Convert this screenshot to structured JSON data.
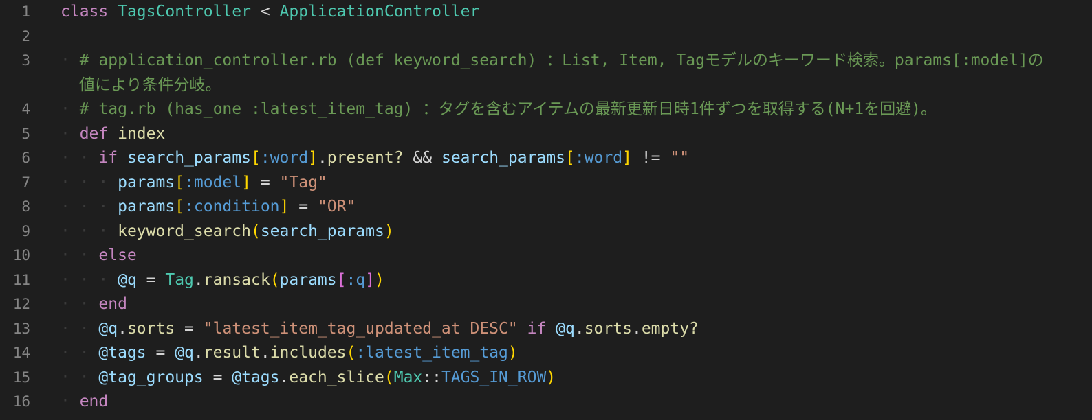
{
  "editor": {
    "colors": {
      "background": "#1e1e1e",
      "line_number": "#858585",
      "keyword": "#c586c0",
      "class_name": "#4ec9b0",
      "comment": "#6a9955",
      "function": "#dcdcaa",
      "variable": "#9cdcfe",
      "symbol": "#569cd6",
      "string": "#ce9178",
      "bracket_level1": "#ffd700",
      "bracket_level2": "#da70d6"
    },
    "lines": [
      {
        "number": "1",
        "tokens": [
          [
            "kw",
            "class"
          ],
          [
            "op",
            " "
          ],
          [
            "cls",
            "TagsController"
          ],
          [
            "op",
            " < "
          ],
          [
            "cls",
            "ApplicationController"
          ]
        ]
      },
      {
        "number": "2",
        "tokens": []
      },
      {
        "number": "3",
        "tokens": [
          [
            "ws",
            "· "
          ],
          [
            "cm",
            "# application_controller.rb (def keyword_search) ：List, Item, Tagモデルのキーワード検索。params[:model]の"
          ]
        ],
        "wrap": "値により条件分岐。"
      },
      {
        "number": "4",
        "tokens": [
          [
            "ws",
            "· "
          ],
          [
            "cm",
            "# tag.rb (has_one :latest_item_tag) ：タグを含むアイテムの最新更新日時1件ずつを取得する(N+1を回避)。"
          ]
        ]
      },
      {
        "number": "5",
        "tokens": [
          [
            "ws",
            "· "
          ],
          [
            "kw",
            "def"
          ],
          [
            "op",
            " "
          ],
          [
            "fn",
            "index"
          ]
        ]
      },
      {
        "number": "6",
        "tokens": [
          [
            "ws",
            "· · "
          ],
          [
            "kw",
            "if"
          ],
          [
            "op",
            " "
          ],
          [
            "var",
            "search_params"
          ],
          [
            "br1",
            "["
          ],
          [
            "sym",
            ":word"
          ],
          [
            "br1",
            "]"
          ],
          [
            "op",
            "."
          ],
          [
            "fn",
            "present?"
          ],
          [
            "op",
            " && "
          ],
          [
            "var",
            "search_params"
          ],
          [
            "br1",
            "["
          ],
          [
            "sym",
            ":word"
          ],
          [
            "br1",
            "]"
          ],
          [
            "op",
            " != "
          ],
          [
            "str",
            "\"\""
          ]
        ]
      },
      {
        "number": "7",
        "tokens": [
          [
            "ws",
            "· · · "
          ],
          [
            "var",
            "params"
          ],
          [
            "br1",
            "["
          ],
          [
            "sym",
            ":model"
          ],
          [
            "br1",
            "]"
          ],
          [
            "op",
            " = "
          ],
          [
            "str",
            "\"Tag\""
          ]
        ]
      },
      {
        "number": "8",
        "tokens": [
          [
            "ws",
            "· · · "
          ],
          [
            "var",
            "params"
          ],
          [
            "br1",
            "["
          ],
          [
            "sym",
            ":condition"
          ],
          [
            "br1",
            "]"
          ],
          [
            "op",
            " = "
          ],
          [
            "str",
            "\"OR\""
          ]
        ]
      },
      {
        "number": "9",
        "tokens": [
          [
            "ws",
            "· · · "
          ],
          [
            "fn",
            "keyword_search"
          ],
          [
            "br1",
            "("
          ],
          [
            "var",
            "search_params"
          ],
          [
            "br1",
            ")"
          ]
        ]
      },
      {
        "number": "10",
        "tokens": [
          [
            "ws",
            "· · "
          ],
          [
            "kw",
            "else"
          ]
        ]
      },
      {
        "number": "11",
        "tokens": [
          [
            "ws",
            "· · · "
          ],
          [
            "var",
            "@q"
          ],
          [
            "op",
            " = "
          ],
          [
            "cls",
            "Tag"
          ],
          [
            "op",
            "."
          ],
          [
            "fn",
            "ransack"
          ],
          [
            "br1",
            "("
          ],
          [
            "var",
            "params"
          ],
          [
            "br2",
            "["
          ],
          [
            "sym",
            ":q"
          ],
          [
            "br2",
            "]"
          ],
          [
            "br1",
            ")"
          ]
        ]
      },
      {
        "number": "12",
        "tokens": [
          [
            "ws",
            "· · "
          ],
          [
            "kw",
            "end"
          ]
        ]
      },
      {
        "number": "13",
        "tokens": [
          [
            "ws",
            "· · "
          ],
          [
            "var",
            "@q"
          ],
          [
            "op",
            "."
          ],
          [
            "fn",
            "sorts"
          ],
          [
            "op",
            " = "
          ],
          [
            "str",
            "\"latest_item_tag_updated_at DESC\""
          ],
          [
            "op",
            " "
          ],
          [
            "kw",
            "if"
          ],
          [
            "op",
            " "
          ],
          [
            "var",
            "@q"
          ],
          [
            "op",
            "."
          ],
          [
            "fn",
            "sorts"
          ],
          [
            "op",
            "."
          ],
          [
            "fn",
            "empty?"
          ]
        ]
      },
      {
        "number": "14",
        "tokens": [
          [
            "ws",
            "· · "
          ],
          [
            "var",
            "@tags"
          ],
          [
            "op",
            " = "
          ],
          [
            "var",
            "@q"
          ],
          [
            "op",
            "."
          ],
          [
            "fn",
            "result"
          ],
          [
            "op",
            "."
          ],
          [
            "fn",
            "includes"
          ],
          [
            "br1",
            "("
          ],
          [
            "sym",
            ":latest_item_tag"
          ],
          [
            "br1",
            ")"
          ]
        ]
      },
      {
        "number": "15",
        "tokens": [
          [
            "ws",
            "· · "
          ],
          [
            "var",
            "@tag_groups"
          ],
          [
            "op",
            " = "
          ],
          [
            "var",
            "@tags"
          ],
          [
            "op",
            "."
          ],
          [
            "fn",
            "each_slice"
          ],
          [
            "br1",
            "("
          ],
          [
            "cls",
            "Max"
          ],
          [
            "op",
            "::"
          ],
          [
            "sym",
            "TAGS_IN_ROW"
          ],
          [
            "br1",
            ")"
          ]
        ]
      },
      {
        "number": "16",
        "tokens": [
          [
            "ws",
            "· "
          ],
          [
            "kw",
            "end"
          ]
        ]
      }
    ]
  }
}
